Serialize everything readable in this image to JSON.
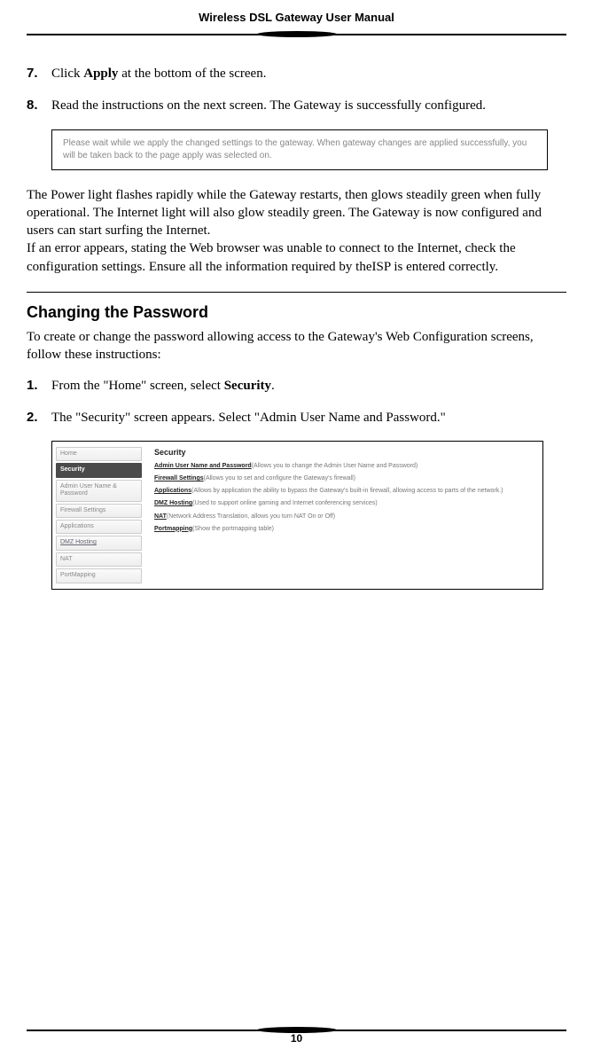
{
  "header": {
    "title": "Wireless DSL Gateway User Manual"
  },
  "steps_a": [
    {
      "num": "7.",
      "text_before": "Click ",
      "bold": "Apply",
      "text_after": " at the bottom of the screen."
    },
    {
      "num": "8.",
      "text_before": "Read the instructions on the next screen. The Gateway is successfully configured.",
      "bold": "",
      "text_after": ""
    }
  ],
  "msgbox": "Please wait while we apply the changed settings to the gateway. When gateway changes are applied successfully, you will be taken back to the page apply was selected on.",
  "para1": "The Power light flashes rapidly while the Gateway restarts, then glows steadily green when fully operational. The Internet light will also glow steadily green. The Gateway is now configured and users can start surfing the Internet.",
  "para2": "If an error appears, stating the Web browser was unable to connect to the Internet, check the configuration settings. Ensure all the information required by theISP is entered correctly.",
  "section": {
    "heading": "Changing the Password",
    "intro": "To create or change the password allowing access to the Gateway's Web Configuration screens, follow these instructions:"
  },
  "steps_b": [
    {
      "num": "1.",
      "text_before": "From the \"Home\" screen, select ",
      "bold": "Security",
      "text_after": "."
    },
    {
      "num": "2.",
      "text_before": "The \"Security\" screen appears. Select \"Admin User Name and Password.\"",
      "bold": "",
      "text_after": ""
    }
  ],
  "screenshot": {
    "sidebar": {
      "home": "Home",
      "security": "Security",
      "admin": "Admin User Name & Password",
      "firewall": "Firewall Settings",
      "applications": "Applications",
      "dmz": "DMZ Hosting",
      "nat": "NAT",
      "portmap": "PortMapping"
    },
    "main": {
      "title": "Security",
      "rows": [
        {
          "link": "Admin User Name and Password",
          "desc": "(Allows you to change the Admin User Name and Password)"
        },
        {
          "link": "Firewall Settings",
          "desc": "(Allows you to set and configure the Gateway's firewall)"
        },
        {
          "link": "Applications",
          "desc": "(Allows by application the ability to bypass the Gateway's built-in firewall, allowing access to parts of the network.)"
        },
        {
          "link": "DMZ Hosting",
          "desc": "(Used to support online gaming and Internet conferencing services)"
        },
        {
          "link": "NAT",
          "desc": "(Network Address Translation, allows you turn NAT On or Off)"
        },
        {
          "link": "Portmapping",
          "desc": "(Show the portmapping table)"
        }
      ]
    }
  },
  "page_number": "10"
}
